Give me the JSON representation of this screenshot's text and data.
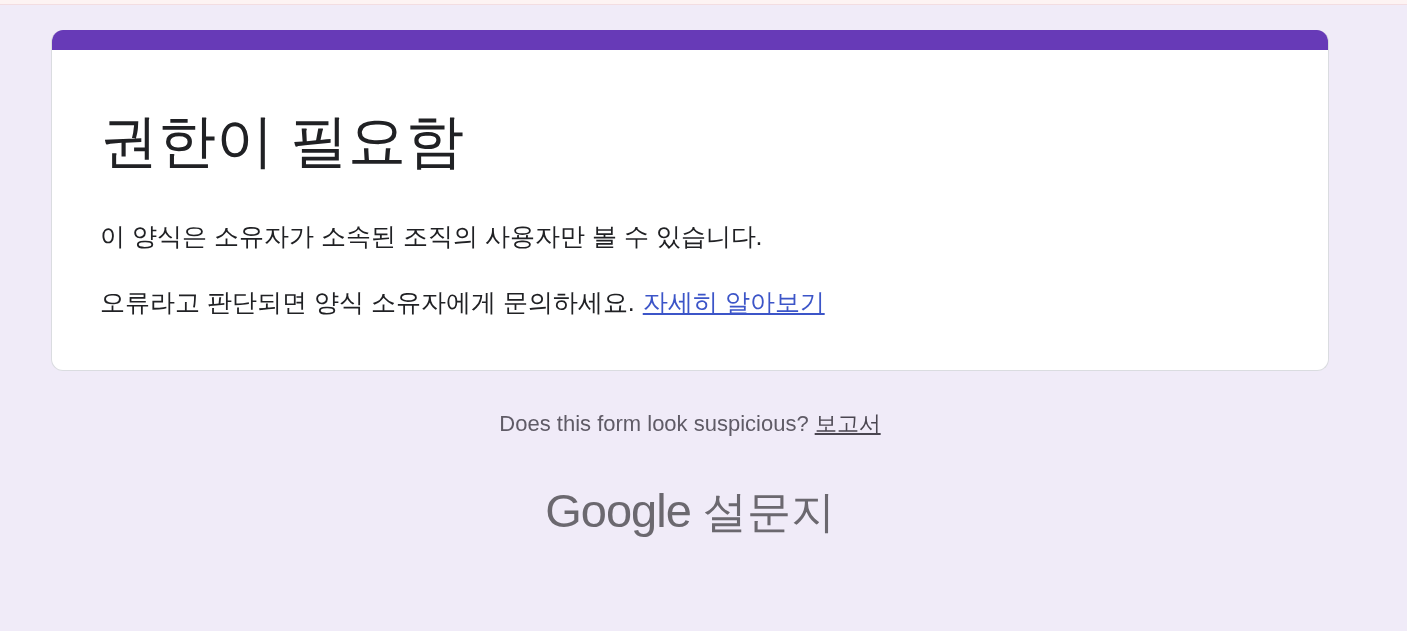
{
  "card": {
    "title": "권한이 필요함",
    "message": "이 양식은 소유자가 소속된 조직의 사용자만 볼 수 있습니다.",
    "notice": "오류라고 판단되면 양식 소유자에게 문의하세요.",
    "learn_more_link": "자세히 알아보기"
  },
  "footer": {
    "question": "Does this form look suspicious?",
    "report_link": "보고서",
    "logo": {
      "brand": "Google",
      "product": "설문지"
    }
  }
}
